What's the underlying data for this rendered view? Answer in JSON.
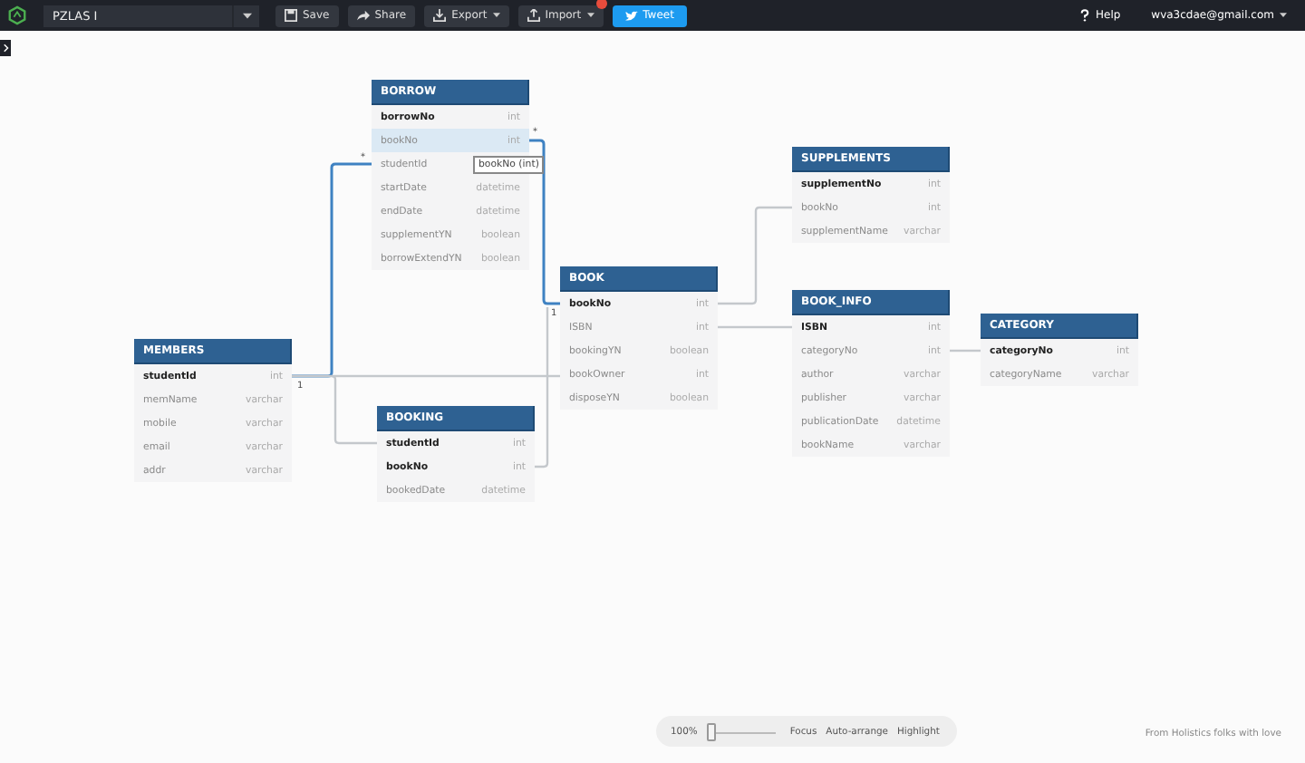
{
  "toolbar": {
    "project": "PZLAS I",
    "buttons": [
      {
        "label": "Save",
        "kind": "save",
        "dropdown": false,
        "notification": false
      },
      {
        "label": "Share",
        "kind": "share",
        "dropdown": false,
        "notification": false
      },
      {
        "label": "Export",
        "kind": "export",
        "dropdown": true,
        "notification": false
      },
      {
        "label": "Import",
        "kind": "import",
        "dropdown": true,
        "notification": true
      }
    ],
    "tweet": "Tweet",
    "help": "Help",
    "account": "wva3cdae@gmail.com"
  },
  "tables": [
    {
      "name": "BORROW",
      "rows": [
        {
          "field": "borrowNo",
          "type": "int",
          "key": true,
          "highlighted": false
        },
        {
          "field": "bookNo",
          "type": "int",
          "key": false,
          "highlighted": true
        },
        {
          "field": "studentId",
          "key": false,
          "highlighted": false
        },
        {
          "field": "startDate",
          "type": "datetime",
          "key": false,
          "highlighted": false
        },
        {
          "field": "endDate",
          "type": "datetime",
          "key": false,
          "highlighted": false
        },
        {
          "field": "supplementYN",
          "type": "boolean",
          "key": false,
          "highlighted": false
        },
        {
          "field": "borrowExtendYN",
          "type": "boolean",
          "key": false,
          "highlighted": false
        }
      ]
    },
    {
      "name": "SUPPLEMENTS",
      "rows": [
        {
          "field": "supplementNo",
          "type": "int",
          "key": true,
          "highlighted": false
        },
        {
          "field": "bookNo",
          "type": "int",
          "key": false,
          "highlighted": false
        },
        {
          "field": "supplementName",
          "type": "varchar",
          "key": false,
          "highlighted": false
        }
      ]
    },
    {
      "name": "BOOK",
      "rows": [
        {
          "field": "bookNo",
          "type": "int",
          "key": true,
          "highlighted": false
        },
        {
          "field": "ISBN",
          "type": "int",
          "key": false,
          "highlighted": false
        },
        {
          "field": "bookingYN",
          "type": "boolean",
          "key": false,
          "highlighted": false
        },
        {
          "field": "bookOwner",
          "type": "int",
          "key": false,
          "highlighted": false
        },
        {
          "field": "disposeYN",
          "type": "boolean",
          "key": false,
          "highlighted": false
        }
      ]
    },
    {
      "name": "BOOK_INFO",
      "rows": [
        {
          "field": "ISBN",
          "type": "int",
          "key": true,
          "highlighted": false
        },
        {
          "field": "categoryNo",
          "type": "int",
          "key": false,
          "highlighted": false
        },
        {
          "field": "author",
          "type": "varchar",
          "key": false,
          "highlighted": false
        },
        {
          "field": "publisher",
          "type": "varchar",
          "key": false,
          "highlighted": false
        },
        {
          "field": "publicationDate",
          "type": "datetime",
          "key": false,
          "highlighted": false
        },
        {
          "field": "bookName",
          "type": "varchar",
          "key": false,
          "highlighted": false
        }
      ]
    },
    {
      "name": "CATEGORY",
      "rows": [
        {
          "field": "categoryNo",
          "type": "int",
          "key": true,
          "highlighted": false
        },
        {
          "field": "categoryName",
          "type": "varchar",
          "key": false,
          "highlighted": false
        }
      ]
    },
    {
      "name": "MEMBERS",
      "rows": [
        {
          "field": "studentId",
          "type": "int",
          "key": true,
          "highlighted": false
        },
        {
          "field": "memName",
          "type": "varchar",
          "key": false,
          "highlighted": false
        },
        {
          "field": "mobile",
          "type": "varchar",
          "key": false,
          "highlighted": false
        },
        {
          "field": "email",
          "type": "varchar",
          "key": false,
          "highlighted": false
        },
        {
          "field": "addr",
          "type": "varchar",
          "key": false,
          "highlighted": false
        }
      ]
    },
    {
      "name": "BOOKING",
      "rows": [
        {
          "field": "studentId",
          "type": "int",
          "key": true,
          "highlighted": false
        },
        {
          "field": "bookNo",
          "type": "int",
          "key": true,
          "highlighted": false
        },
        {
          "field": "bookedDate",
          "type": "datetime",
          "key": false,
          "highlighted": false
        }
      ]
    }
  ],
  "tooltip": "bookNo (int)",
  "relations": [
    {
      "highlighted": true,
      "from_label": "1",
      "to_label": "*"
    },
    {
      "highlighted": true,
      "from_label": "*",
      "to_label": "1"
    },
    {
      "highlighted": false
    },
    {
      "highlighted": false
    },
    {
      "highlighted": false
    },
    {
      "highlighted": false
    },
    {
      "highlighted": false
    },
    {
      "highlighted": false
    }
  ],
  "zoom": {
    "reading": "100%",
    "level": 0,
    "actions": [
      "Focus",
      "Auto-arrange",
      "Highlight"
    ]
  },
  "footer": "From Holistics folks with love"
}
